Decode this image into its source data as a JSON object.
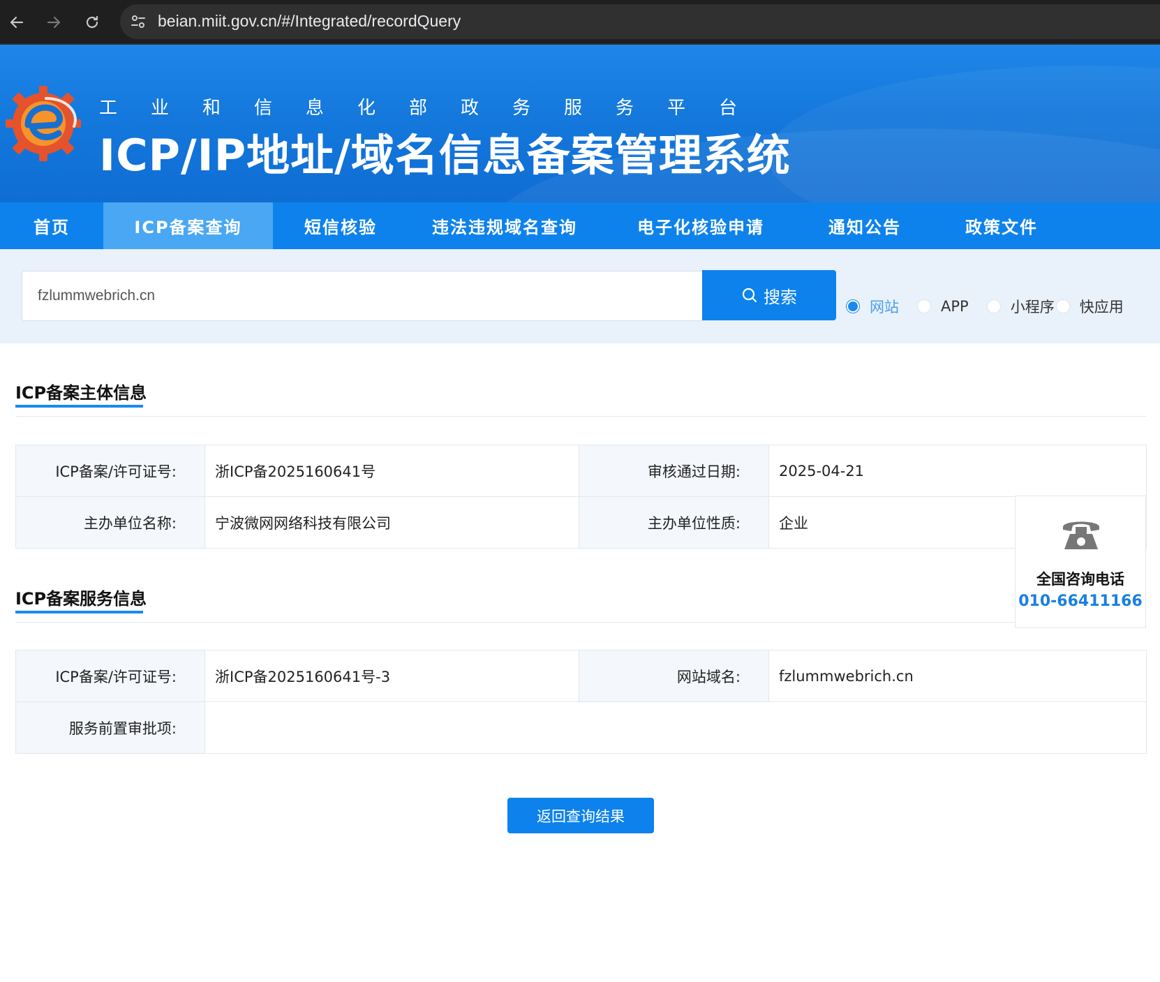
{
  "browser": {
    "url": "beian.miit.gov.cn/#/Integrated/recordQuery"
  },
  "header": {
    "ministry": "工业和信息化部政务服务平台",
    "system_title": "ICP/IP地址/域名信息备案管理系统"
  },
  "nav": {
    "items": [
      {
        "label": "首页"
      },
      {
        "label": "ICP备案查询"
      },
      {
        "label": "短信核验"
      },
      {
        "label": "违法违规域名查询"
      },
      {
        "label": "电子化核验申请"
      },
      {
        "label": "通知公告"
      },
      {
        "label": "政策文件"
      }
    ],
    "active_index": 1
  },
  "search": {
    "value": "fzlummwebrich.cn",
    "button_label": "搜索",
    "options": [
      {
        "label": "网站",
        "checked": true
      },
      {
        "label": "APP",
        "checked": false
      },
      {
        "label": "小程序",
        "checked": false
      },
      {
        "label": "快应用",
        "checked": false
      }
    ]
  },
  "subject": {
    "title": "ICP备案主体信息",
    "license_label": "ICP备案/许可证号:",
    "license_value": "浙ICP备2025160641号",
    "approval_date_label": "审核通过日期:",
    "approval_date_value": "2025-04-21",
    "org_name_label": "主办单位名称:",
    "org_name_value": "宁波微网网络科技有限公司",
    "org_type_label": "主办单位性质:",
    "org_type_value": "企业"
  },
  "service": {
    "title": "ICP备案服务信息",
    "license_label": "ICP备案/许可证号:",
    "license_value": "浙ICP备2025160641号-3",
    "domain_label": "网站域名:",
    "domain_value": "fzlummwebrich.cn",
    "preapproval_label": "服务前置审批项:",
    "preapproval_value": ""
  },
  "hotline": {
    "label": "全国咨询电话",
    "number": "010-66411166"
  },
  "back_button_label": "返回查询结果",
  "colors": {
    "primary": "#0d82ec",
    "nav_active": "#49a7f4",
    "search_bg": "#e9f1fa",
    "label_bg": "#f4f7fb",
    "hotline_text": "#1a7fe0"
  }
}
